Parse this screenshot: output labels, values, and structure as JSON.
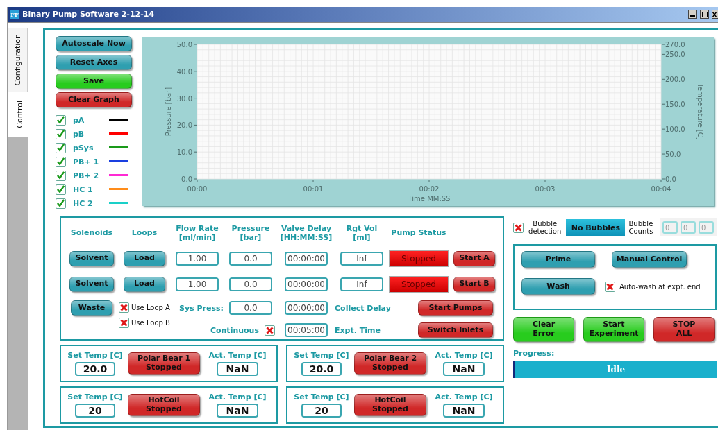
{
  "window": {
    "icon_text": "FF",
    "title": "Binary Pump Software 2-12-14"
  },
  "tabs": [
    {
      "label": "Configuration",
      "selected": false
    },
    {
      "label": "Control",
      "selected": true
    }
  ],
  "graph_buttons": [
    {
      "label": "Autoscale Now",
      "color": "#2f9fb0"
    },
    {
      "label": "Reset Axes",
      "color": "#2f9fb0"
    },
    {
      "label": "Save",
      "color": "#28cc1e"
    },
    {
      "label": "Clear Graph",
      "color": "#d02828"
    }
  ],
  "legend": [
    {
      "label": "pA",
      "checked": true,
      "color": "#000000"
    },
    {
      "label": "pB",
      "checked": true,
      "color": "#ff0000"
    },
    {
      "label": "pSys",
      "checked": true,
      "color": "#1a9a1a"
    },
    {
      "label": "PB+ 1",
      "checked": true,
      "color": "#1a3fe0"
    },
    {
      "label": "PB+ 2",
      "checked": true,
      "color": "#ff2ad4"
    },
    {
      "label": "HC 1",
      "checked": true,
      "color": "#ff8c1a"
    },
    {
      "label": "HC 2",
      "checked": true,
      "color": "#1ad0c8"
    }
  ],
  "chart": {
    "chart_data": {
      "type": "line",
      "grid": true,
      "xlabel": "Time MM:SS",
      "ylabel": "Pressure [bar]",
      "xlim": [
        0,
        4
      ],
      "ylim": [
        0,
        50
      ],
      "xticks": [
        {
          "value": 0,
          "label": "00:00"
        },
        {
          "value": 1,
          "label": "00:01"
        },
        {
          "value": 2,
          "label": "00:02"
        },
        {
          "value": 3,
          "label": "00:03"
        },
        {
          "value": 4,
          "label": "00:04"
        }
      ],
      "yticks": [
        {
          "value": 0,
          "label": "0.0"
        },
        {
          "value": 10,
          "label": "10.0"
        },
        {
          "value": 20,
          "label": "20.0"
        },
        {
          "value": 30,
          "label": "30.0"
        },
        {
          "value": 40,
          "label": "40.0"
        },
        {
          "value": 50,
          "label": "50.0"
        }
      ]
    },
    "right_axis": {
      "label": "Temperature [C]",
      "ticks": [
        "270.0",
        "250.0",
        "200.0",
        "150.0",
        "100.0",
        "50.0",
        "0.0"
      ]
    }
  },
  "pump": {
    "columns": [
      "Solenoids",
      "Loops",
      "Flow Rate\n[ml/min]",
      "Pressure\n[bar]",
      "Valve Delay\n[HH:MM:SS]",
      "Rgt Vol\n[ml]",
      "Pump Status"
    ],
    "rows": [
      {
        "solenoid": "Solvent",
        "loop": "Load",
        "flow_rate": "1.00",
        "pressure": "0.0",
        "valve_delay": "00:00:00",
        "rgt_vol": "Inf",
        "status": "Stopped",
        "running": false,
        "start": "Start A"
      },
      {
        "solenoid": "Solvent",
        "loop": "Load",
        "flow_rate": "1.00",
        "pressure": "0.0",
        "valve_delay": "00:00:00",
        "rgt_vol": "Inf",
        "status": "Stopped",
        "running": false,
        "start": "Start B"
      }
    ],
    "waste": "Waste",
    "loop_options": [
      {
        "label": "Use Loop A",
        "checked": true
      },
      {
        "label": "Use Loop B",
        "checked": true
      }
    ],
    "sys_press": {
      "label": "Sys Press:",
      "value": "0.0"
    },
    "collect_delay": {
      "value": "00:00:00",
      "label": "Collect Delay"
    },
    "continuous": {
      "label": "Continuous",
      "checked": true
    },
    "expt_time": {
      "value": "00:05:00",
      "label": "Expt. Time"
    },
    "actions": [
      "Start Pumps",
      "Switch Inlets"
    ]
  },
  "temperature_controllers": [
    {
      "set_label": "Set Temp [C]",
      "set_value": "20.0",
      "name": "Polar Bear 1",
      "status": "Stopped",
      "running": false,
      "act_label": "Act. Temp [C]",
      "act_value": "NaN"
    },
    {
      "set_label": "Set Temp [C]",
      "set_value": "20.0",
      "name": "Polar Bear 2",
      "status": "Stopped",
      "running": false,
      "act_label": "Act. Temp [C]",
      "act_value": "NaN"
    },
    {
      "set_label": "Set Temp [C]",
      "set_value": "20",
      "name": "HotCoil",
      "status": "Stopped",
      "running": false,
      "act_label": "Act. Temp [C]",
      "act_value": "NaN"
    },
    {
      "set_label": "Set Temp [C]",
      "set_value": "20",
      "name": "HotCoil",
      "status": "Stopped",
      "running": false,
      "act_label": "Act. Temp [C]",
      "act_value": "NaN"
    }
  ],
  "bubble": {
    "detection": {
      "label": "Bubble detection",
      "checked": true
    },
    "indicator": "No Bubbles",
    "counts_label": "Bubble Counts",
    "counts": [
      "0",
      "0",
      "0"
    ]
  },
  "maintenance": {
    "buttons": [
      "Prime",
      "Manual Control",
      "Wash"
    ],
    "auto_wash": {
      "label": "Auto-wash at expt. end",
      "checked": true
    }
  },
  "experiment_buttons": [
    {
      "label": "Clear Error",
      "color": "#28cc1e"
    },
    {
      "label": "Start Experiment",
      "color": "#28cc1e"
    },
    {
      "label": "STOP ALL",
      "color": "#d02828"
    }
  ],
  "progress": {
    "label": "Progress:",
    "status": "Idle",
    "level": 0
  }
}
